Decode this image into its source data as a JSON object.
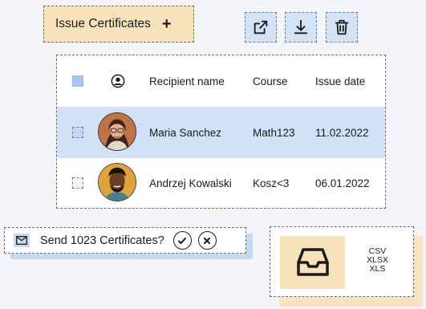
{
  "toolbar": {
    "issue_label": "Issue Certificates",
    "issue_plus": "+",
    "icons": [
      "share-export-icon",
      "download-icon",
      "trash-icon"
    ]
  },
  "table": {
    "headers": {
      "recipient": "Recipient name",
      "course": "Course",
      "date": "Issue date"
    },
    "rows": [
      {
        "name": "Maria Sanchez",
        "course": "Math123",
        "date": "11.02.2022",
        "selected": true
      },
      {
        "name": "Andrzej Kowalski",
        "course": "Kosz<3",
        "date": "06.01.2022",
        "selected": false
      }
    ]
  },
  "send": {
    "label": "Send 1023 Certificates?"
  },
  "export": {
    "formats": [
      "CSV",
      "XLSX",
      "XLS"
    ]
  },
  "colors": {
    "accent_blue": "#d1e1f6",
    "accent_peach": "#f8e2bc"
  }
}
